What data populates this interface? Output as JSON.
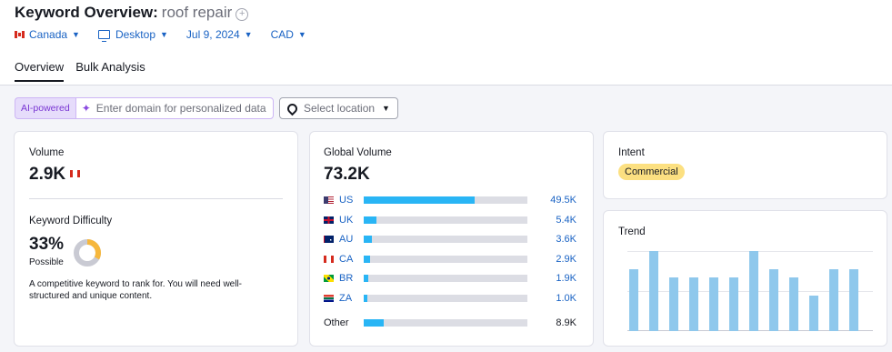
{
  "header": {
    "title": "Keyword Overview:",
    "keyword": "roof repair",
    "filters": {
      "country": "Canada",
      "device": "Desktop",
      "date": "Jul 9, 2024",
      "currency": "CAD"
    },
    "tabs": [
      "Overview",
      "Bulk Analysis"
    ]
  },
  "toolbar": {
    "ai_badge": "AI-powered",
    "domain_placeholder": "Enter domain for personalized data",
    "location_placeholder": "Select location"
  },
  "volume": {
    "label": "Volume",
    "value": "2.9K"
  },
  "difficulty": {
    "label": "Keyword Difficulty",
    "percent": "33%",
    "level": "Possible",
    "description": "A competitive keyword to rank for. You will need well-structured and unique content.",
    "score": 33,
    "color": "#f6b73c"
  },
  "global_volume": {
    "label": "Global Volume",
    "value": "73.2K",
    "rows": [
      {
        "code": "US",
        "value": "49.5K",
        "share": 0.68
      },
      {
        "code": "UK",
        "value": "5.4K",
        "share": 0.08
      },
      {
        "code": "AU",
        "value": "3.6K",
        "share": 0.05
      },
      {
        "code": "CA",
        "value": "2.9K",
        "share": 0.04
      },
      {
        "code": "BR",
        "value": "1.9K",
        "share": 0.03
      },
      {
        "code": "ZA",
        "value": "1.0K",
        "share": 0.02
      }
    ],
    "other": {
      "label": "Other",
      "value": "8.9K",
      "share": 0.12
    }
  },
  "intent": {
    "label": "Intent",
    "value": "Commercial"
  },
  "trend": {
    "label": "Trend",
    "values": [
      0.77,
      1.0,
      0.67,
      0.67,
      0.67,
      0.67,
      1.0,
      0.77,
      0.67,
      0.44,
      0.77,
      0.77
    ]
  },
  "colors": {
    "accent": "#1a63c4",
    "bar": "#29b5f5",
    "trend_bar": "#8fc8ec",
    "intent_badge": "#fce081",
    "ai_purple": "#7a37d3"
  }
}
